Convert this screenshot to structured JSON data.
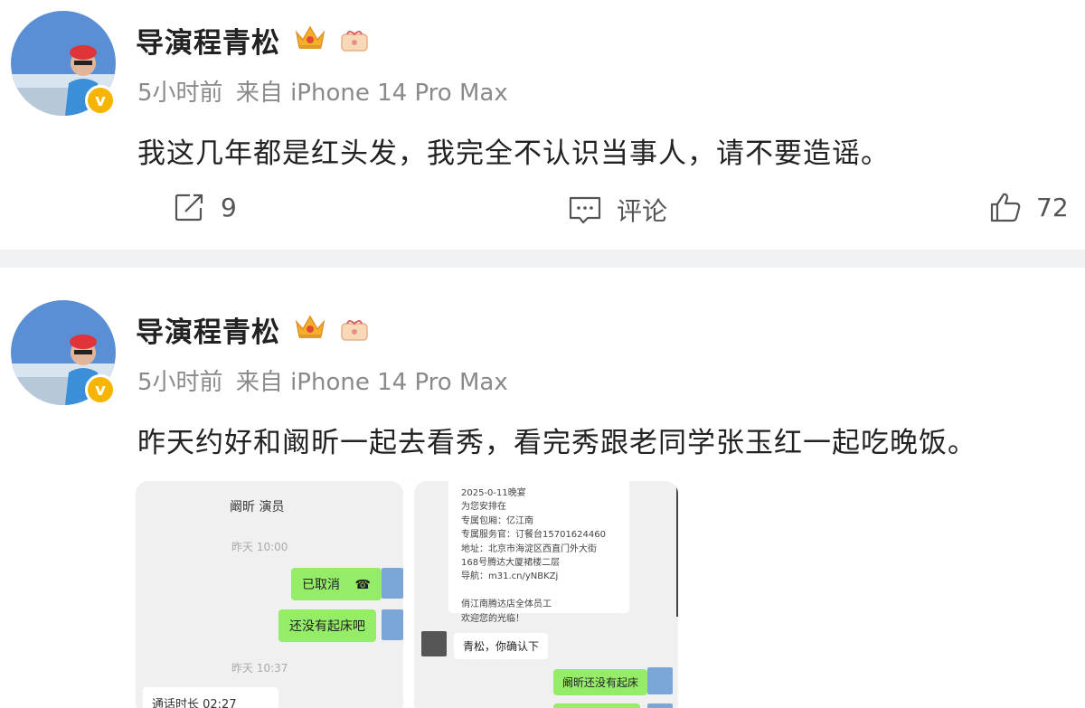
{
  "posts": [
    {
      "author": "导演程青松",
      "time": "5小时前",
      "source": "来自 iPhone 14 Pro Max",
      "text": "我这几年都是红头发，我完全不认识当事人，请不要造谣。",
      "actions": {
        "share_count": "9",
        "comment_label": "评论",
        "like_count": "72"
      }
    },
    {
      "author": "导演程青松",
      "time": "5小时前",
      "source": "来自 iPhone 14 Pro Max",
      "text": "昨天约好和阚昕一起去看秀，看完秀跟老同学张玉红一起吃晚饭。",
      "screenshot_left": {
        "title": "阚昕 演员",
        "time1": "昨天 10:00",
        "bubble1": "已取消",
        "bubble2": "还没有起床吧",
        "time2": "昨天 10:37",
        "call": "通话时长 02:27"
      },
      "screenshot_right": {
        "card_lines": [
          "2025-0-11晚宴",
          "为您安排在",
          "专属包厢：亿江南",
          "专属服务官：订餐台15701624460",
          "地址：北京市海淀区西直门外大街",
          "168号腾达大厦裙楼二层",
          "导航：m31.cn/yNBKZj",
          "",
          "俏江南腾达店全体员工",
          "欢迎您的光临！"
        ],
        "bubble1": "青松，你确认下",
        "bubble2": "阚昕还没有起床"
      }
    }
  ],
  "badge_letter": "v",
  "colors": {
    "verified": "#f6b500",
    "wechat_green": "#95ec69",
    "divider": "#f1f2f4"
  }
}
